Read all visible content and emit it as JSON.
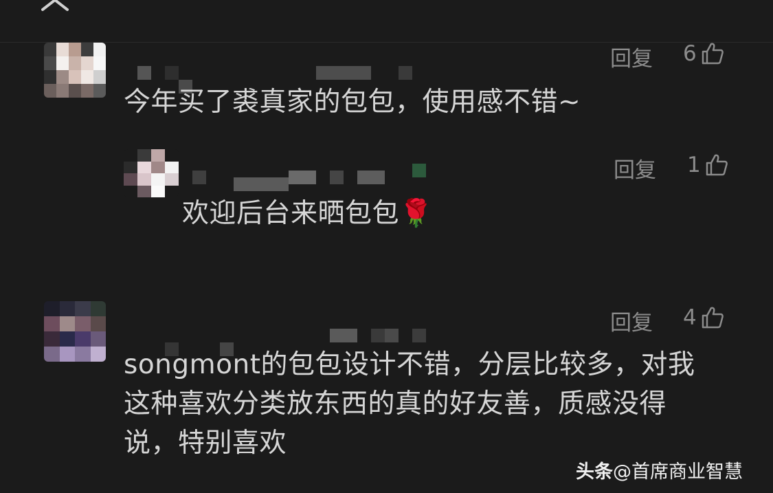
{
  "header": {
    "close_icon": "close-icon",
    "more_icon": "more-icon"
  },
  "comments": [
    {
      "text": "今年买了裘真家的包包，使用感不错~",
      "reply_label": "回复",
      "likes": "6"
    },
    {
      "text": "欢迎后台来晒包包🌹",
      "reply_label": "回复",
      "likes": "1"
    },
    {
      "text_lines": [
        "songmont的包包设计不错，分层比较多，对我",
        "这种喜欢分类放东西的真的好友善，质感没得",
        "说，特别喜欢"
      ],
      "reply_label": "回复",
      "likes": "4"
    }
  ],
  "watermark": {
    "brand": "头条",
    "account": "@首席商业智慧"
  },
  "colors": {
    "background": "#1b1b1b",
    "text": "#d6d6d6",
    "secondary": "#8c8c8c"
  }
}
